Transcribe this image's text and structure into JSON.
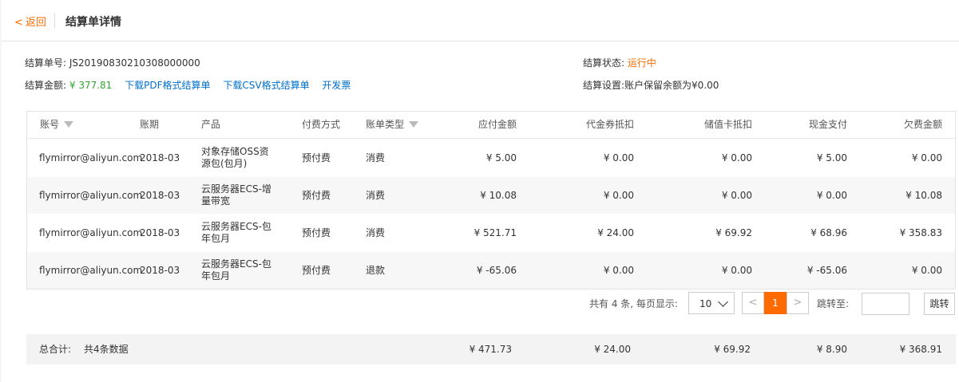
{
  "header": {
    "back_chev": "<",
    "back_label": "返回",
    "title": "结算单详情"
  },
  "info": {
    "bill_no_label": "结算单号:",
    "bill_no": "JS20190830210308000000",
    "amount_label": "结算金额:",
    "amount": "¥ 377.81",
    "download_pdf": "下载PDF格式结算单",
    "download_csv": "下载CSV格式结算单",
    "invoice": "开发票",
    "status_label": "结算状态:",
    "status": "运行中",
    "settings_label": "结算设置:",
    "settings": "账户保留余额为¥0.00"
  },
  "table": {
    "headers": [
      "账号",
      "账期",
      "产品",
      "付费方式",
      "账单类型",
      "应付金额",
      "代金券抵扣",
      "储值卡抵扣",
      "现金支付",
      "欠费金额"
    ],
    "rows": [
      {
        "account": "flymirror@aliyun.com",
        "period": "2018-03",
        "product": "对象存储OSS资源包(包月)",
        "pay": "预付费",
        "type": "消费",
        "due": "¥ 5.00",
        "voucher": "¥ 0.00",
        "card": "¥ 0.00",
        "cash": "¥ 5.00",
        "owed": "¥ 0.00"
      },
      {
        "account": "flymirror@aliyun.com",
        "period": "2018-03",
        "product": "云服务器ECS-增量带宽",
        "pay": "预付费",
        "type": "消费",
        "due": "¥ 10.08",
        "voucher": "¥ 0.00",
        "card": "¥ 0.00",
        "cash": "¥ 0.00",
        "owed": "¥ 10.08"
      },
      {
        "account": "flymirror@aliyun.com",
        "period": "2018-03",
        "product": "云服务器ECS-包年包月",
        "pay": "预付费",
        "type": "消费",
        "due": "¥ 521.71",
        "voucher": "¥ 24.00",
        "card": "¥ 69.92",
        "cash": "¥ 68.96",
        "owed": "¥ 358.83"
      },
      {
        "account": "flymirror@aliyun.com",
        "period": "2018-03",
        "product": "云服务器ECS-包年包月",
        "pay": "预付费",
        "type": "退款",
        "due": "¥ -65.06",
        "voucher": "¥ 0.00",
        "card": "¥ 0.00",
        "cash": "¥ -65.06",
        "owed": "¥ 0.00"
      }
    ]
  },
  "pager": {
    "summary": "共有 4 条, 每页显示:",
    "page_size": "10",
    "prev": "<",
    "current": "1",
    "next": ">",
    "jump_label": "跳转至:",
    "jump_value": "",
    "go": "跳转"
  },
  "total": {
    "label": "总合计:",
    "count": "共4条数据",
    "due": "¥ 471.73",
    "voucher": "¥ 24.00",
    "card": "¥ 69.92",
    "cash": "¥ 8.90",
    "owed": "¥ 368.91"
  },
  "colors": {
    "accent": "#ff6a00",
    "link": "#0070cc",
    "money": "#2fa52f"
  }
}
